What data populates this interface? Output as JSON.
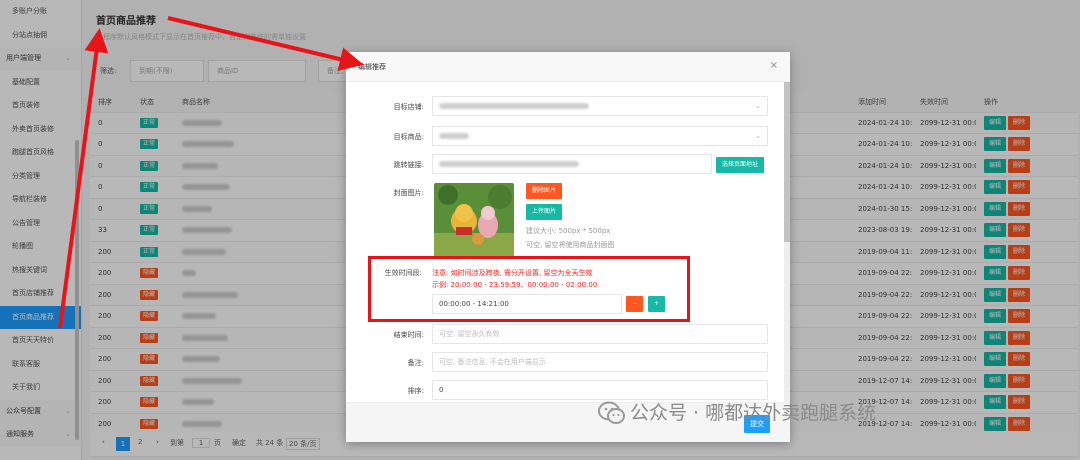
{
  "sidebar": {
    "items": [
      {
        "label": "多账户分账",
        "type": "item"
      },
      {
        "label": "分站点抽佣",
        "type": "item"
      },
      {
        "label": "用户端管理",
        "type": "group"
      },
      {
        "label": "基础配置",
        "type": "item"
      },
      {
        "label": "首页装修",
        "type": "item"
      },
      {
        "label": "外卖首页装修",
        "type": "item"
      },
      {
        "label": "跑腿首页风格",
        "type": "item"
      },
      {
        "label": "分类管理",
        "type": "item"
      },
      {
        "label": "导航栏装修",
        "type": "item"
      },
      {
        "label": "公告管理",
        "type": "item"
      },
      {
        "label": "轮播图",
        "type": "item"
      },
      {
        "label": "热搜关键词",
        "type": "item"
      },
      {
        "label": "首页店铺推荐",
        "type": "item"
      },
      {
        "label": "首页商品推荐",
        "type": "active"
      },
      {
        "label": "首页天天特价",
        "type": "item"
      },
      {
        "label": "联系客服",
        "type": "item"
      },
      {
        "label": "关于我们",
        "type": "item"
      },
      {
        "label": "公众号配置",
        "type": "group"
      },
      {
        "label": "通知服务",
        "type": "group"
      }
    ]
  },
  "page": {
    "title": "首页商品推荐",
    "desc": "小程序默认风格模式下显示在首页推荐中，自定义装修的需单独设置"
  },
  "filter": {
    "label": "筛选:",
    "status_placeholder": "到期(不限)",
    "goods_id_placeholder": "商品ID",
    "remark_placeholder": "备注, 支持模糊"
  },
  "table": {
    "headers": [
      "排序",
      "状态",
      "商品名称",
      "添加时间",
      "失效时间",
      "操作"
    ],
    "edit_label": "编辑",
    "delete_label": "删除",
    "rows": [
      {
        "sort": "0",
        "status": "正常",
        "status_type": "on",
        "added": "2024-01-24 10:46",
        "expire": "2099-12-31 00:00"
      },
      {
        "sort": "0",
        "status": "正常",
        "status_type": "on",
        "added": "2024-01-24 10:46",
        "expire": "2099-12-31 00:00"
      },
      {
        "sort": "0",
        "status": "正常",
        "status_type": "on",
        "added": "2024-01-24 10:57",
        "expire": "2099-12-31 00:00"
      },
      {
        "sort": "0",
        "status": "正常",
        "status_type": "on",
        "added": "2024-01-24 10:58",
        "expire": "2099-12-31 00:00"
      },
      {
        "sort": "0",
        "status": "正常",
        "status_type": "on",
        "added": "2024-01-30 15:03",
        "expire": "2099-12-31 00:00"
      },
      {
        "sort": "33",
        "status": "正常",
        "status_type": "on",
        "added": "2023-08-03 19:56",
        "expire": "2099-12-31 00:00"
      },
      {
        "sort": "200",
        "status": "正常",
        "status_type": "on",
        "added": "2019-09-04 11:42",
        "expire": "2099-12-31 00:00"
      },
      {
        "sort": "200",
        "status": "隐藏",
        "status_type": "off",
        "added": "2019-09-04 22:31",
        "expire": "2099-12-31 00:00"
      },
      {
        "sort": "200",
        "status": "隐藏",
        "status_type": "off",
        "added": "2019-09-04 22:32",
        "expire": "2099-12-31 00:00"
      },
      {
        "sort": "200",
        "status": "隐藏",
        "status_type": "off",
        "added": "2019-09-04 22:32",
        "expire": "2099-12-31 00:00"
      },
      {
        "sort": "200",
        "status": "隐藏",
        "status_type": "off",
        "added": "2019-09-04 22:32",
        "expire": "2099-12-31 00:00"
      },
      {
        "sort": "200",
        "status": "隐藏",
        "status_type": "off",
        "added": "2019-09-04 22:32",
        "expire": "2099-12-31 00:00"
      },
      {
        "sort": "200",
        "status": "隐藏",
        "status_type": "off",
        "added": "2019-12-07 14:39",
        "expire": "2099-12-31 00:00"
      },
      {
        "sort": "200",
        "status": "隐藏",
        "status_type": "off",
        "added": "2019-12-07 14:39",
        "expire": "2099-12-31 00:00"
      },
      {
        "sort": "200",
        "status": "隐藏",
        "status_type": "off",
        "added": "2019-12-07 14:39",
        "expire": "2099-12-31 00:00"
      },
      {
        "sort": "200",
        "status": "隐藏",
        "status_type": "off",
        "added": "2023-03-28 12:54",
        "expire": "2099-12-31 00:00"
      }
    ]
  },
  "pager": {
    "prev": "‹",
    "page1": "1",
    "page2": "2",
    "next": "›",
    "goto_label": "到第",
    "goto_value": "1",
    "page_unit": "页",
    "confirm": "确定",
    "total": "共 24 条",
    "per_page": "20 条/页"
  },
  "modal": {
    "title": "编辑推荐",
    "close": "×",
    "store_label": "目标店铺:",
    "goods_label": "目标商品:",
    "link_label": "跳转链接:",
    "link_button": "选择页面地址",
    "cover_label": "封面图片:",
    "delete_image": "删除图片",
    "upload_image": "上传图片",
    "size_hint": "建议大小: 500px * 500px",
    "size_hint2": "可空, 留空将使用商品封面图",
    "time_label": "生效时间段:",
    "time_note1": "注意: 如时间涉及跨夜, 需分开设置, 留空为全天生效",
    "time_note2": "示例: 20:00:00 - 23:59:59、00:00:00 - 02:00:00",
    "time_value": "00:00:00 - 14:21:00",
    "time_del": "−",
    "time_add": "+",
    "end_label": "结束时间:",
    "end_placeholder": "可空, 留空永久有效",
    "remark_label": "备注:",
    "remark_placeholder": "可空, 备注信息, 不会在用户端显示",
    "sort_label": "排序:",
    "sort_value": "0",
    "submit": "提交"
  },
  "watermark": {
    "text": "公众号 · 哪都达外卖跑腿系统"
  },
  "colors": {
    "primary": "#1e9fff",
    "teal": "#16b9a5",
    "danger": "#ff5722",
    "annotation": "#e8141a"
  }
}
